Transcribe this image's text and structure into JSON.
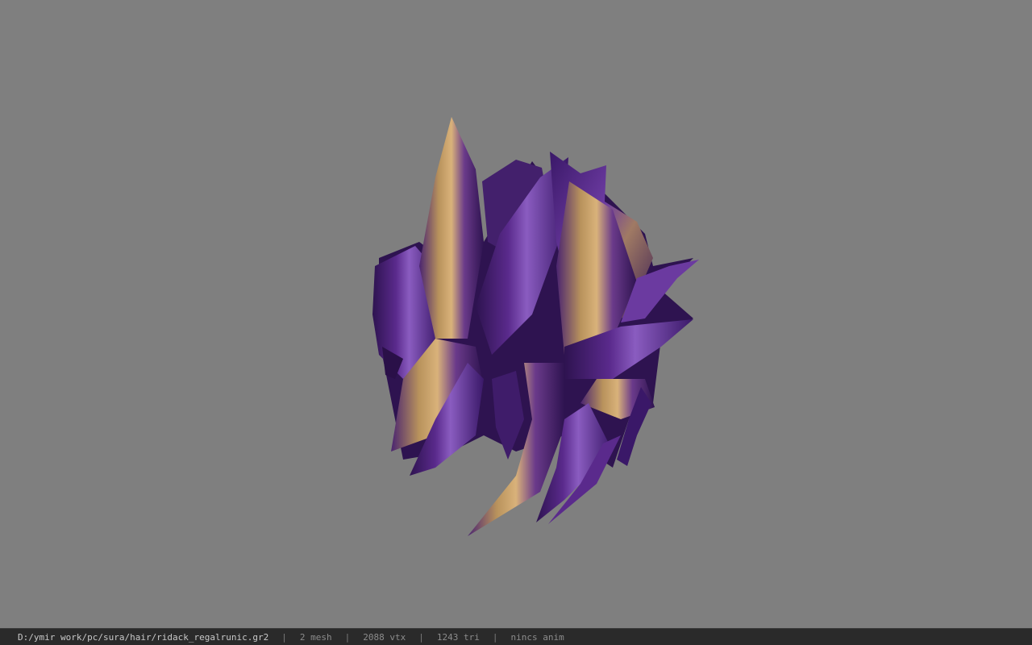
{
  "viewer": {
    "background_color": "#7f7f7f",
    "model": {
      "subject": "purple spiky hair mesh with gold streaks",
      "colors": {
        "dark_purple": "#2e1350",
        "purple": "#5a2a8c",
        "light_purple": "#8a5cc0",
        "gold": "#b8925c"
      }
    }
  },
  "status_bar": {
    "file_path": "D:/ymir work/pc/sura/hair/ridack_regalrunic.gr2",
    "separator": "|",
    "mesh_count": "2 mesh",
    "vertex_count": "2088 vtx",
    "triangle_count": "1243 tri",
    "anim_status": "nincs anim"
  }
}
